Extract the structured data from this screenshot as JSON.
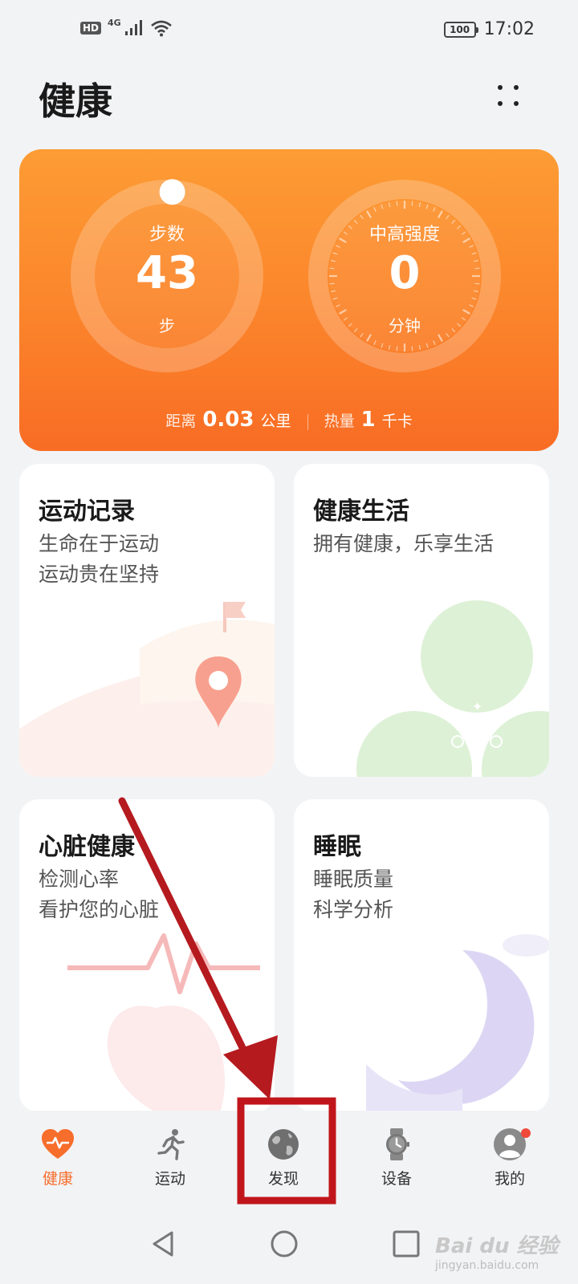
{
  "status_bar": {
    "hd": "HD",
    "network": "4G",
    "battery": "100",
    "time": "17:02"
  },
  "header": {
    "title": "健康"
  },
  "activity": {
    "steps": {
      "label": "步数",
      "value": "43",
      "unit": "步",
      "progress_fraction": 0.01
    },
    "intensity": {
      "label": "中高强度",
      "value": "0",
      "unit": "分钟"
    },
    "distance": {
      "label": "距离",
      "value": "0.03",
      "unit": "公里"
    },
    "calories": {
      "label": "热量",
      "value": "1",
      "unit": "千卡"
    }
  },
  "cards": [
    {
      "title": "运动记录",
      "subtitle_1": "生命在于运动",
      "subtitle_2": "运动贵在坚持"
    },
    {
      "title": "健康生活",
      "subtitle_1": "拥有健康，乐享生活"
    },
    {
      "title": "心脏健康",
      "subtitle_1": "检测心率",
      "subtitle_2": "看护您的心脏"
    },
    {
      "title": "睡眠",
      "subtitle_1": "睡眠质量",
      "subtitle_2": "科学分析"
    }
  ],
  "bottom_nav": {
    "items": [
      {
        "label": "健康",
        "icon": "heart-pulse-icon",
        "active": true
      },
      {
        "label": "运动",
        "icon": "running-icon"
      },
      {
        "label": "发现",
        "icon": "globe-icon",
        "highlighted": true
      },
      {
        "label": "设备",
        "icon": "watch-icon"
      },
      {
        "label": "我的",
        "icon": "avatar-icon",
        "badge": true
      }
    ]
  },
  "watermark": {
    "logo": "Bai du 经验",
    "url": "jingyan.baidu.com"
  },
  "colors": {
    "accent": "#f76d2b",
    "card_top": "#fd9c34",
    "card_bottom": "#f86c24",
    "annotation": "#c0161b"
  }
}
